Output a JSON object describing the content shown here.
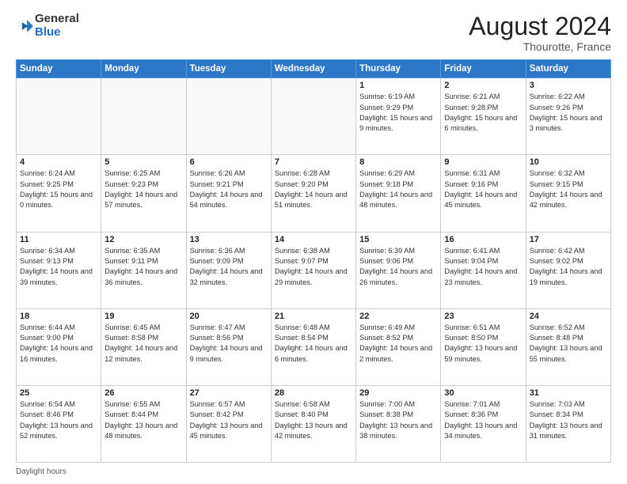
{
  "header": {
    "logo_general": "General",
    "logo_blue": "Blue",
    "month_year": "August 2024",
    "location": "Thourotte, France"
  },
  "footer": {
    "label": "Daylight hours"
  },
  "days_of_week": [
    "Sunday",
    "Monday",
    "Tuesday",
    "Wednesday",
    "Thursday",
    "Friday",
    "Saturday"
  ],
  "weeks": [
    [
      {
        "day": "",
        "info": ""
      },
      {
        "day": "",
        "info": ""
      },
      {
        "day": "",
        "info": ""
      },
      {
        "day": "",
        "info": ""
      },
      {
        "day": "1",
        "info": "Sunrise: 6:19 AM\nSunset: 9:29 PM\nDaylight: 15 hours and 9 minutes."
      },
      {
        "day": "2",
        "info": "Sunrise: 6:21 AM\nSunset: 9:28 PM\nDaylight: 15 hours and 6 minutes."
      },
      {
        "day": "3",
        "info": "Sunrise: 6:22 AM\nSunset: 9:26 PM\nDaylight: 15 hours and 3 minutes."
      }
    ],
    [
      {
        "day": "4",
        "info": "Sunrise: 6:24 AM\nSunset: 9:25 PM\nDaylight: 15 hours and 0 minutes."
      },
      {
        "day": "5",
        "info": "Sunrise: 6:25 AM\nSunset: 9:23 PM\nDaylight: 14 hours and 57 minutes."
      },
      {
        "day": "6",
        "info": "Sunrise: 6:26 AM\nSunset: 9:21 PM\nDaylight: 14 hours and 54 minutes."
      },
      {
        "day": "7",
        "info": "Sunrise: 6:28 AM\nSunset: 9:20 PM\nDaylight: 14 hours and 51 minutes."
      },
      {
        "day": "8",
        "info": "Sunrise: 6:29 AM\nSunset: 9:18 PM\nDaylight: 14 hours and 48 minutes."
      },
      {
        "day": "9",
        "info": "Sunrise: 6:31 AM\nSunset: 9:16 PM\nDaylight: 14 hours and 45 minutes."
      },
      {
        "day": "10",
        "info": "Sunrise: 6:32 AM\nSunset: 9:15 PM\nDaylight: 14 hours and 42 minutes."
      }
    ],
    [
      {
        "day": "11",
        "info": "Sunrise: 6:34 AM\nSunset: 9:13 PM\nDaylight: 14 hours and 39 minutes."
      },
      {
        "day": "12",
        "info": "Sunrise: 6:35 AM\nSunset: 9:11 PM\nDaylight: 14 hours and 36 minutes."
      },
      {
        "day": "13",
        "info": "Sunrise: 6:36 AM\nSunset: 9:09 PM\nDaylight: 14 hours and 32 minutes."
      },
      {
        "day": "14",
        "info": "Sunrise: 6:38 AM\nSunset: 9:07 PM\nDaylight: 14 hours and 29 minutes."
      },
      {
        "day": "15",
        "info": "Sunrise: 6:39 AM\nSunset: 9:06 PM\nDaylight: 14 hours and 26 minutes."
      },
      {
        "day": "16",
        "info": "Sunrise: 6:41 AM\nSunset: 9:04 PM\nDaylight: 14 hours and 23 minutes."
      },
      {
        "day": "17",
        "info": "Sunrise: 6:42 AM\nSunset: 9:02 PM\nDaylight: 14 hours and 19 minutes."
      }
    ],
    [
      {
        "day": "18",
        "info": "Sunrise: 6:44 AM\nSunset: 9:00 PM\nDaylight: 14 hours and 16 minutes."
      },
      {
        "day": "19",
        "info": "Sunrise: 6:45 AM\nSunset: 8:58 PM\nDaylight: 14 hours and 12 minutes."
      },
      {
        "day": "20",
        "info": "Sunrise: 6:47 AM\nSunset: 8:56 PM\nDaylight: 14 hours and 9 minutes."
      },
      {
        "day": "21",
        "info": "Sunrise: 6:48 AM\nSunset: 8:54 PM\nDaylight: 14 hours and 6 minutes."
      },
      {
        "day": "22",
        "info": "Sunrise: 6:49 AM\nSunset: 8:52 PM\nDaylight: 14 hours and 2 minutes."
      },
      {
        "day": "23",
        "info": "Sunrise: 6:51 AM\nSunset: 8:50 PM\nDaylight: 13 hours and 59 minutes."
      },
      {
        "day": "24",
        "info": "Sunrise: 6:52 AM\nSunset: 8:48 PM\nDaylight: 13 hours and 55 minutes."
      }
    ],
    [
      {
        "day": "25",
        "info": "Sunrise: 6:54 AM\nSunset: 8:46 PM\nDaylight: 13 hours and 52 minutes."
      },
      {
        "day": "26",
        "info": "Sunrise: 6:55 AM\nSunset: 8:44 PM\nDaylight: 13 hours and 48 minutes."
      },
      {
        "day": "27",
        "info": "Sunrise: 6:57 AM\nSunset: 8:42 PM\nDaylight: 13 hours and 45 minutes."
      },
      {
        "day": "28",
        "info": "Sunrise: 6:58 AM\nSunset: 8:40 PM\nDaylight: 13 hours and 42 minutes."
      },
      {
        "day": "29",
        "info": "Sunrise: 7:00 AM\nSunset: 8:38 PM\nDaylight: 13 hours and 38 minutes."
      },
      {
        "day": "30",
        "info": "Sunrise: 7:01 AM\nSunset: 8:36 PM\nDaylight: 13 hours and 34 minutes."
      },
      {
        "day": "31",
        "info": "Sunrise: 7:03 AM\nSunset: 8:34 PM\nDaylight: 13 hours and 31 minutes."
      }
    ]
  ]
}
